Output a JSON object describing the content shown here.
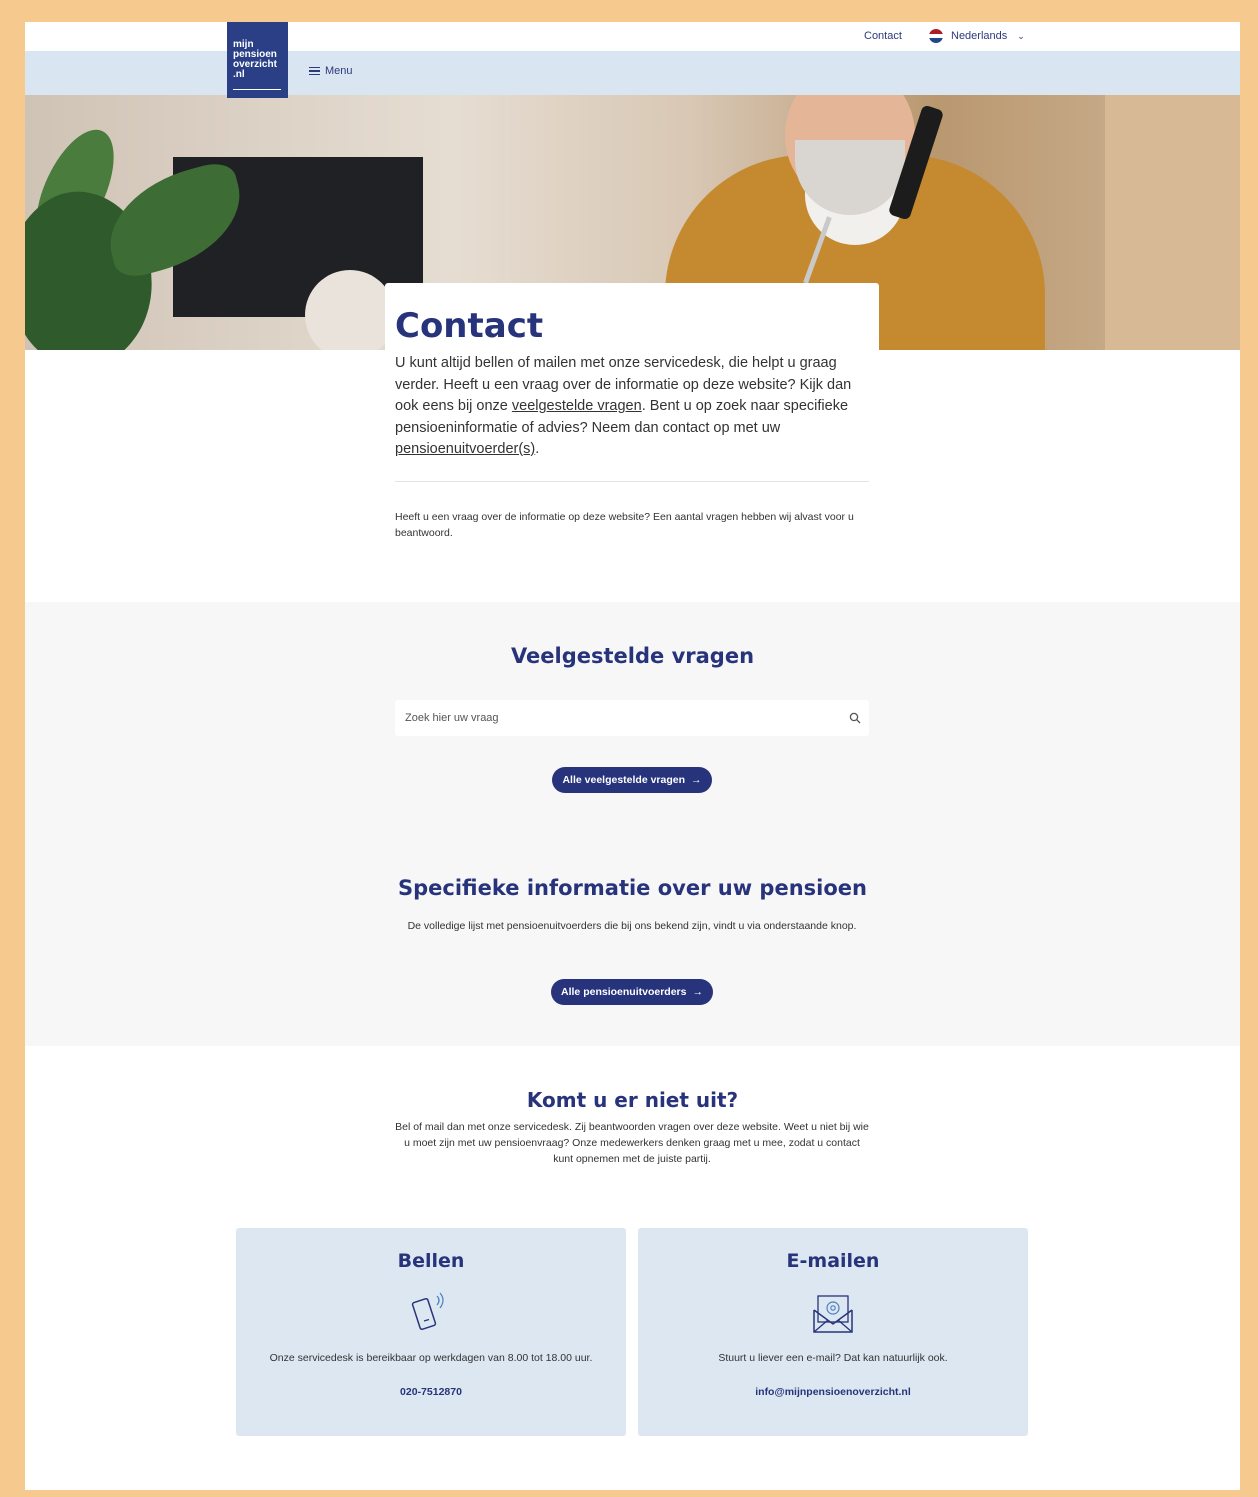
{
  "header": {
    "contact_link": "Contact",
    "language": "Nederlands",
    "menu_label": "Menu",
    "logo_lines": [
      "mijn",
      "pensioen",
      "overzicht",
      ".nl"
    ]
  },
  "intro": {
    "title": "Contact",
    "text_1": "U kunt altijd bellen of mailen met onze servicedesk, die helpt u graag verder. Heeft u een vraag over de informatie op deze website? Kijk dan ook eens bij onze ",
    "link_faq": "veelgestelde vragen",
    "text_2": ". Bent u op zoek naar specifieke pensioeninformatie of advies? Neem dan contact op met uw ",
    "link_providers": "pensioenuitvoerder(s)",
    "text_3": ".",
    "note": "Heeft u een vraag over de informatie op deze website? Een aantal vragen hebben wij alvast voor u beantwoord."
  },
  "faq": {
    "title": "Veelgestelde vragen",
    "search_placeholder": "Zoek hier uw vraag",
    "button": "Alle veelgestelde vragen"
  },
  "specific": {
    "title": "Specifieke informatie over uw pensioen",
    "description": "De volledige lijst met pensioenuitvoerders die bij ons bekend zijn, vindt u via onderstaande knop.",
    "button": "Alle pensioenuitvoerders"
  },
  "help": {
    "title": "Komt u er niet uit?",
    "description": "Bel of mail dan met onze servicedesk. Zij beantwoorden vragen over deze website. Weet u niet bij wie u moet zijn met uw pensioenvraag? Onze medewerkers denken graag met u mee, zodat u contact kunt opnemen met de juiste partij."
  },
  "tiles": {
    "call": {
      "title": "Bellen",
      "icon": "phone-icon",
      "description": "Onze servicedesk is bereikbaar op werkdagen van 8.00 tot 18.00 uur.",
      "value": "020-7512870"
    },
    "mail": {
      "title": "E-mailen",
      "icon": "envelope-icon",
      "description": "Stuurt u liever een e-mail? Dat kan natuurlijk ook.",
      "value": "info@mijnpensioenoverzicht.nl"
    }
  },
  "colors": {
    "brand": "#27337a",
    "nav_band": "#d9e5f0",
    "tile_bg": "#dde7f1",
    "section_bg": "#f7f7f7",
    "frame": "#f6c98f"
  }
}
